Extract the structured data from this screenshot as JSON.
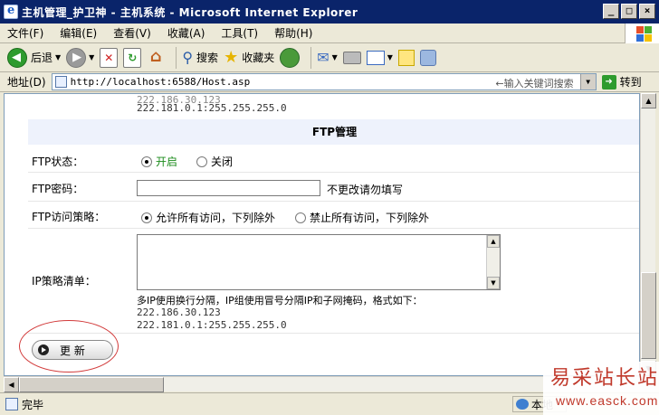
{
  "window": {
    "title": "主机管理_护卫神 - 主机系统 - Microsoft Internet Explorer",
    "buttons": {
      "minimize": "_",
      "maximize": "□",
      "close": "×"
    }
  },
  "menu": [
    "文件(F)",
    "编辑(E)",
    "查看(V)",
    "收藏(A)",
    "工具(T)",
    "帮助(H)"
  ],
  "toolbar": {
    "back": "后退",
    "search": "搜索",
    "favorites": "收藏夹"
  },
  "address": {
    "label": "地址(D)",
    "url": "http://localhost:6588/Host.asp",
    "hint": "←输入关键词搜索",
    "go": "转到"
  },
  "page": {
    "top_ips": [
      "222.186.30.123",
      "222.181.0.1:255.255.255.0"
    ],
    "section_title": "FTP管理",
    "ftp_status": {
      "label": "FTP状态：",
      "options": [
        "开启",
        "关闭"
      ],
      "selected": "开启"
    },
    "ftp_password": {
      "label": "FTP密码：",
      "value": "",
      "hint": "不更改请勿填写"
    },
    "ftp_policy": {
      "label": "FTP访问策略：",
      "options": [
        "允许所有访问，下列除外",
        "禁止所有访问，下列除外"
      ],
      "selected": "允许所有访问，下列除外"
    },
    "ip_policy": {
      "label": "IP策略清单：",
      "value": "",
      "note": "多IP使用换行分隔，IP组使用冒号分隔IP和子网掩码，格式如下：",
      "examples": [
        "222.186.30.123",
        "222.181.0.1:255.255.255.0"
      ]
    },
    "update_button": "更 新"
  },
  "status": {
    "text": "完毕",
    "zone": "本地"
  },
  "watermark": {
    "name": "易采站长站",
    "url": "www.easck.com"
  },
  "colors": {
    "title_bar": "#0a246a",
    "section_bg": "#eef2fc",
    "selected_option": "#1c8c1c",
    "highlight_oval": "#d23b3b"
  }
}
